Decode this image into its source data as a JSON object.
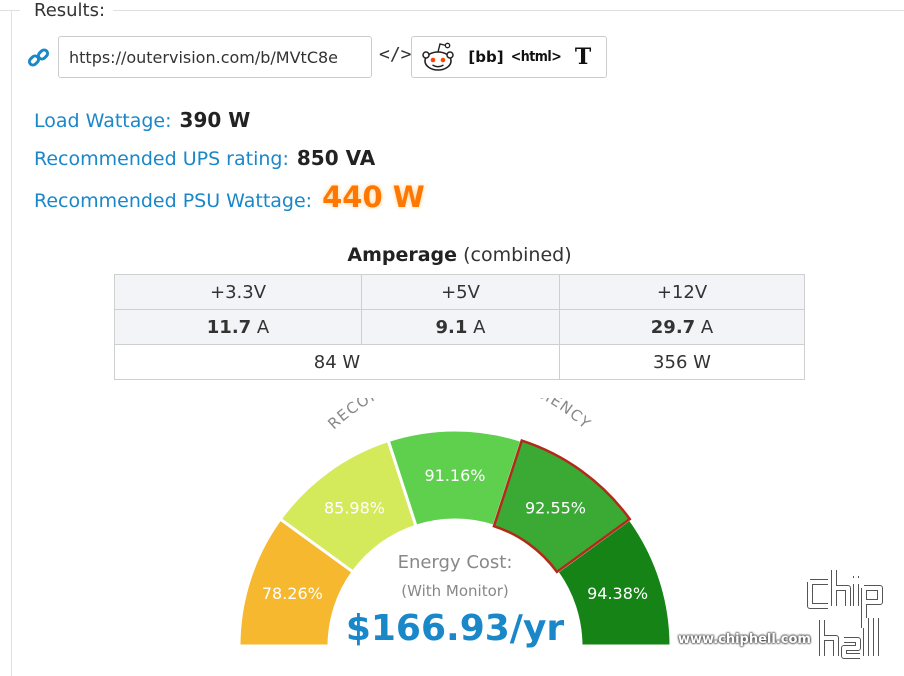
{
  "results_label": "Results:",
  "share": {
    "url": "https://outervision.com/b/MVtC8e",
    "embed_icon": "</>",
    "reddit_icon": "reddit-icon",
    "bbcode_label": "[bb]",
    "html_label": "<html>",
    "text_label": "T"
  },
  "results": {
    "load_label": "Load Wattage:",
    "load_value": "390 W",
    "ups_label": "Recommended UPS rating:",
    "ups_value": "850 VA",
    "psu_label": "Recommended PSU Wattage:",
    "psu_value": "440 W"
  },
  "amperage": {
    "title_bold": "Amperage",
    "title_rest": " (combined)",
    "rails": [
      "+3.3V",
      "+5V",
      "+12V"
    ],
    "amps": [
      {
        "value": "11.7",
        "unit": " A"
      },
      {
        "value": "9.1",
        "unit": " A"
      },
      {
        "value": "29.7",
        "unit": " A"
      }
    ],
    "watts_low": "84 W",
    "watts_12v": "356 W"
  },
  "gauge": {
    "title": "RECOMMENDED PSU EFFICIENCY",
    "segments": [
      {
        "label": "78.26%",
        "color": "#f5b82e"
      },
      {
        "label": "85.98%",
        "color": "#d4ea5b"
      },
      {
        "label": "91.16%",
        "color": "#5fd04e"
      },
      {
        "label": "92.55%",
        "color": "#3aaa35",
        "selected": true
      },
      {
        "label": "94.38%",
        "color": "#158316"
      }
    ],
    "selected_outline": "#b32a1a",
    "cost_label": "Energy Cost:",
    "cost_sub": "(With Monitor)",
    "cost_value": "$166.93/yr"
  },
  "watermark": {
    "text": "www.chiphell.com"
  }
}
